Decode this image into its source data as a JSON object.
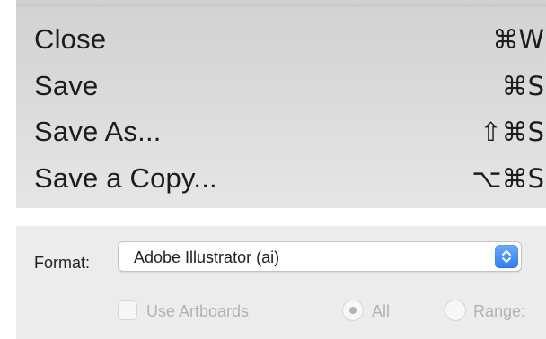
{
  "menu": {
    "items": [
      {
        "label": "Close",
        "shortcut": "⌘W"
      },
      {
        "label": "Save",
        "shortcut": "⌘S"
      },
      {
        "label": "Save As...",
        "shortcut": "⇧⌘S"
      },
      {
        "label": "Save a Copy...",
        "shortcut": "⌥⌘S"
      }
    ]
  },
  "format_panel": {
    "format_label": "Format:",
    "format_selected": "Adobe Illustrator (ai)",
    "use_artboards_label": "Use Artboards",
    "use_artboards_checked": false,
    "all_label": "All",
    "all_selected": true,
    "range_label": "Range:",
    "range_selected": false,
    "disabled": true,
    "accent_color": "#2f7ef4"
  }
}
